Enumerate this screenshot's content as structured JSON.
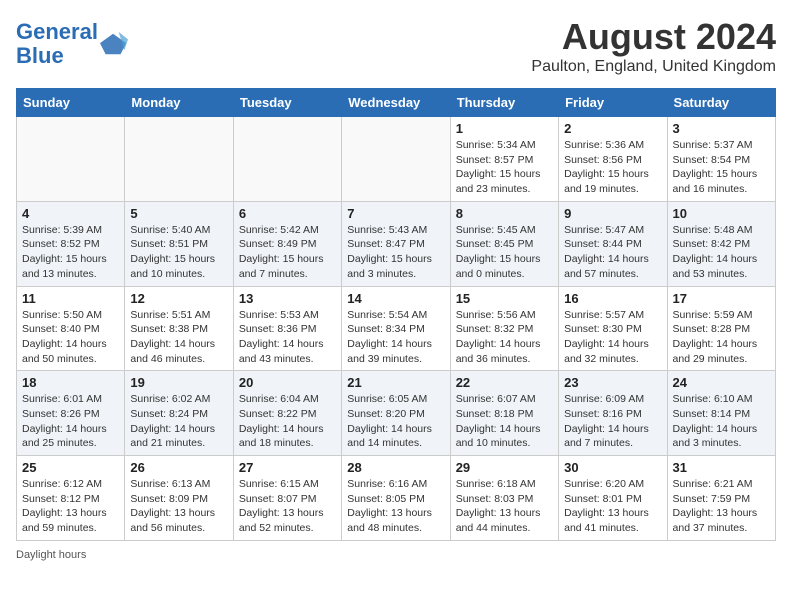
{
  "header": {
    "logo_line1": "General",
    "logo_line2": "Blue",
    "title": "August 2024",
    "subtitle": "Paulton, England, United Kingdom"
  },
  "days_of_week": [
    "Sunday",
    "Monday",
    "Tuesday",
    "Wednesday",
    "Thursday",
    "Friday",
    "Saturday"
  ],
  "footer_note": "Daylight hours",
  "weeks": [
    {
      "days": [
        {
          "num": "",
          "info": ""
        },
        {
          "num": "",
          "info": ""
        },
        {
          "num": "",
          "info": ""
        },
        {
          "num": "",
          "info": ""
        },
        {
          "num": "1",
          "info": "Sunrise: 5:34 AM\nSunset: 8:57 PM\nDaylight: 15 hours\nand 23 minutes."
        },
        {
          "num": "2",
          "info": "Sunrise: 5:36 AM\nSunset: 8:56 PM\nDaylight: 15 hours\nand 19 minutes."
        },
        {
          "num": "3",
          "info": "Sunrise: 5:37 AM\nSunset: 8:54 PM\nDaylight: 15 hours\nand 16 minutes."
        }
      ]
    },
    {
      "days": [
        {
          "num": "4",
          "info": "Sunrise: 5:39 AM\nSunset: 8:52 PM\nDaylight: 15 hours\nand 13 minutes."
        },
        {
          "num": "5",
          "info": "Sunrise: 5:40 AM\nSunset: 8:51 PM\nDaylight: 15 hours\nand 10 minutes."
        },
        {
          "num": "6",
          "info": "Sunrise: 5:42 AM\nSunset: 8:49 PM\nDaylight: 15 hours\nand 7 minutes."
        },
        {
          "num": "7",
          "info": "Sunrise: 5:43 AM\nSunset: 8:47 PM\nDaylight: 15 hours\nand 3 minutes."
        },
        {
          "num": "8",
          "info": "Sunrise: 5:45 AM\nSunset: 8:45 PM\nDaylight: 15 hours\nand 0 minutes."
        },
        {
          "num": "9",
          "info": "Sunrise: 5:47 AM\nSunset: 8:44 PM\nDaylight: 14 hours\nand 57 minutes."
        },
        {
          "num": "10",
          "info": "Sunrise: 5:48 AM\nSunset: 8:42 PM\nDaylight: 14 hours\nand 53 minutes."
        }
      ]
    },
    {
      "days": [
        {
          "num": "11",
          "info": "Sunrise: 5:50 AM\nSunset: 8:40 PM\nDaylight: 14 hours\nand 50 minutes."
        },
        {
          "num": "12",
          "info": "Sunrise: 5:51 AM\nSunset: 8:38 PM\nDaylight: 14 hours\nand 46 minutes."
        },
        {
          "num": "13",
          "info": "Sunrise: 5:53 AM\nSunset: 8:36 PM\nDaylight: 14 hours\nand 43 minutes."
        },
        {
          "num": "14",
          "info": "Sunrise: 5:54 AM\nSunset: 8:34 PM\nDaylight: 14 hours\nand 39 minutes."
        },
        {
          "num": "15",
          "info": "Sunrise: 5:56 AM\nSunset: 8:32 PM\nDaylight: 14 hours\nand 36 minutes."
        },
        {
          "num": "16",
          "info": "Sunrise: 5:57 AM\nSunset: 8:30 PM\nDaylight: 14 hours\nand 32 minutes."
        },
        {
          "num": "17",
          "info": "Sunrise: 5:59 AM\nSunset: 8:28 PM\nDaylight: 14 hours\nand 29 minutes."
        }
      ]
    },
    {
      "days": [
        {
          "num": "18",
          "info": "Sunrise: 6:01 AM\nSunset: 8:26 PM\nDaylight: 14 hours\nand 25 minutes."
        },
        {
          "num": "19",
          "info": "Sunrise: 6:02 AM\nSunset: 8:24 PM\nDaylight: 14 hours\nand 21 minutes."
        },
        {
          "num": "20",
          "info": "Sunrise: 6:04 AM\nSunset: 8:22 PM\nDaylight: 14 hours\nand 18 minutes."
        },
        {
          "num": "21",
          "info": "Sunrise: 6:05 AM\nSunset: 8:20 PM\nDaylight: 14 hours\nand 14 minutes."
        },
        {
          "num": "22",
          "info": "Sunrise: 6:07 AM\nSunset: 8:18 PM\nDaylight: 14 hours\nand 10 minutes."
        },
        {
          "num": "23",
          "info": "Sunrise: 6:09 AM\nSunset: 8:16 PM\nDaylight: 14 hours\nand 7 minutes."
        },
        {
          "num": "24",
          "info": "Sunrise: 6:10 AM\nSunset: 8:14 PM\nDaylight: 14 hours\nand 3 minutes."
        }
      ]
    },
    {
      "days": [
        {
          "num": "25",
          "info": "Sunrise: 6:12 AM\nSunset: 8:12 PM\nDaylight: 13 hours\nand 59 minutes."
        },
        {
          "num": "26",
          "info": "Sunrise: 6:13 AM\nSunset: 8:09 PM\nDaylight: 13 hours\nand 56 minutes."
        },
        {
          "num": "27",
          "info": "Sunrise: 6:15 AM\nSunset: 8:07 PM\nDaylight: 13 hours\nand 52 minutes."
        },
        {
          "num": "28",
          "info": "Sunrise: 6:16 AM\nSunset: 8:05 PM\nDaylight: 13 hours\nand 48 minutes."
        },
        {
          "num": "29",
          "info": "Sunrise: 6:18 AM\nSunset: 8:03 PM\nDaylight: 13 hours\nand 44 minutes."
        },
        {
          "num": "30",
          "info": "Sunrise: 6:20 AM\nSunset: 8:01 PM\nDaylight: 13 hours\nand 41 minutes."
        },
        {
          "num": "31",
          "info": "Sunrise: 6:21 AM\nSunset: 7:59 PM\nDaylight: 13 hours\nand 37 minutes."
        }
      ]
    }
  ]
}
